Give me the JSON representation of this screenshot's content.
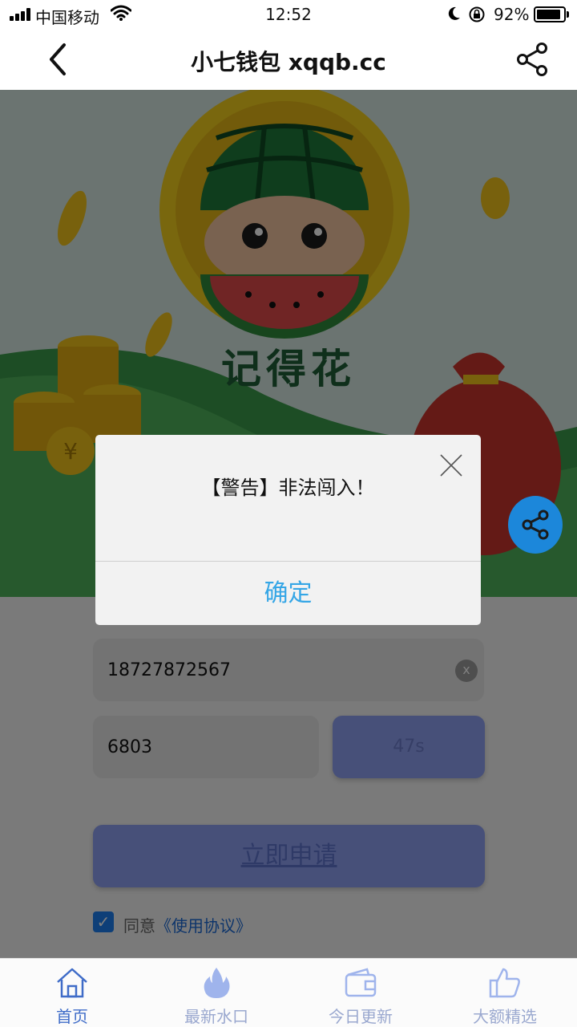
{
  "status_bar": {
    "carrier": "中国移动",
    "time": "12:52",
    "battery_percent_label": "92%",
    "battery_level": 0.92
  },
  "nav": {
    "title": "小七钱包 xqqb.cc",
    "back_icon": "chevron-left-icon",
    "share_icon": "share-icon"
  },
  "banner": {
    "caption": "记得花"
  },
  "form": {
    "phone_value": "18727872567",
    "clear_label": "x",
    "code_value": "6803",
    "countdown_label": "47s",
    "apply_label": "立即申请",
    "agree_text": "同意",
    "agreement_link": "《使用协议》",
    "agree_checked": true
  },
  "dialog": {
    "message": "【警告】非法闯入！",
    "confirm_label": "确定"
  },
  "tabs": [
    {
      "label": "首页",
      "icon": "home-icon",
      "active": true
    },
    {
      "label": "最新水口",
      "icon": "flame-icon",
      "active": false
    },
    {
      "label": "今日更新",
      "icon": "wallet-icon",
      "active": false
    },
    {
      "label": "大额精选",
      "icon": "thumbs-up-icon",
      "active": false
    }
  ],
  "colors": {
    "accent_blue": "#1d7ff0",
    "dialog_confirm": "#35a6e6",
    "button_fill": "#8ea1f2",
    "tab_active": "#3f6cc8"
  }
}
